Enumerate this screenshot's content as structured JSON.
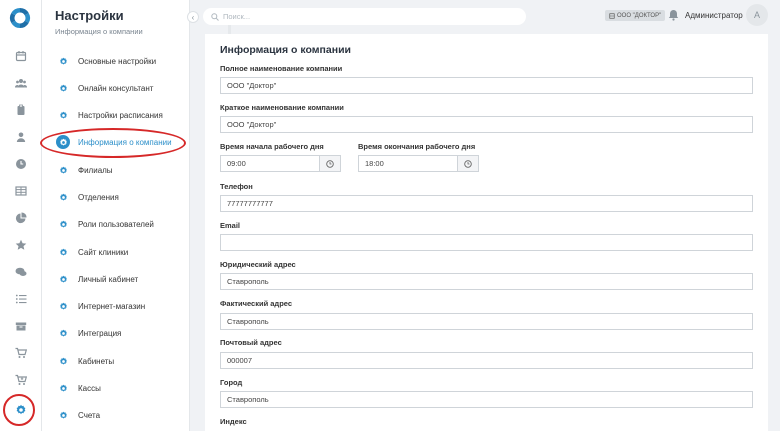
{
  "rail": {
    "icons": [
      "logo-icon",
      "calendar-icon",
      "users-icon",
      "clipboard-icon",
      "user-icon",
      "clock-icon",
      "table-icon",
      "pie-chart-icon",
      "star-icon",
      "chat-icon",
      "list-icon",
      "box-icon",
      "cart-icon",
      "cart-plus-icon",
      "gear-icon"
    ]
  },
  "submenu": {
    "title": "Настройки",
    "subtitle": "Информация о компании",
    "items": [
      {
        "label": "Основные настройки"
      },
      {
        "label": "Онлайн консультант"
      },
      {
        "label": "Настройки расписания"
      },
      {
        "label": "Информация о компании"
      },
      {
        "label": "Филиалы"
      },
      {
        "label": "Отделения"
      },
      {
        "label": "Роли пользователей"
      },
      {
        "label": "Сайт клиники"
      },
      {
        "label": "Личный кабинет"
      },
      {
        "label": "Интернет-магазин"
      },
      {
        "label": "Интеграция"
      },
      {
        "label": "Кабинеты"
      },
      {
        "label": "Кассы"
      },
      {
        "label": "Счета"
      }
    ]
  },
  "topbar": {
    "search_placeholder": "Поиск...",
    "clinic_badge": "ООО \"ДОКТОР\"",
    "user_name": "Администратор",
    "avatar_letter": "А"
  },
  "form": {
    "title": "Информация о компании",
    "full_name_label": "Полное наименование компании",
    "full_name_value": "ООО \"Доктор\"",
    "short_name_label": "Краткое наименование компании",
    "short_name_value": "ООО \"Доктор\"",
    "start_label": "Время начала рабочего дня",
    "start_value": "09:00",
    "end_label": "Время окончания рабочего дня",
    "end_value": "18:00",
    "phone_label": "Телефон",
    "phone_value": "77777777777",
    "email_label": "Email",
    "email_value": "",
    "legal_address_label": "Юридический адрес",
    "legal_address_value": "Ставрополь",
    "actual_address_label": "Фактический адрес",
    "actual_address_value": "Ставрополь",
    "postal_address_label": "Почтовый адрес",
    "postal_address_value": "000007",
    "city_label": "Город",
    "city_value": "Ставрополь",
    "index_label": "Индекс"
  },
  "colors": {
    "accent": "#2c8fc9",
    "annotation": "#d62828"
  }
}
